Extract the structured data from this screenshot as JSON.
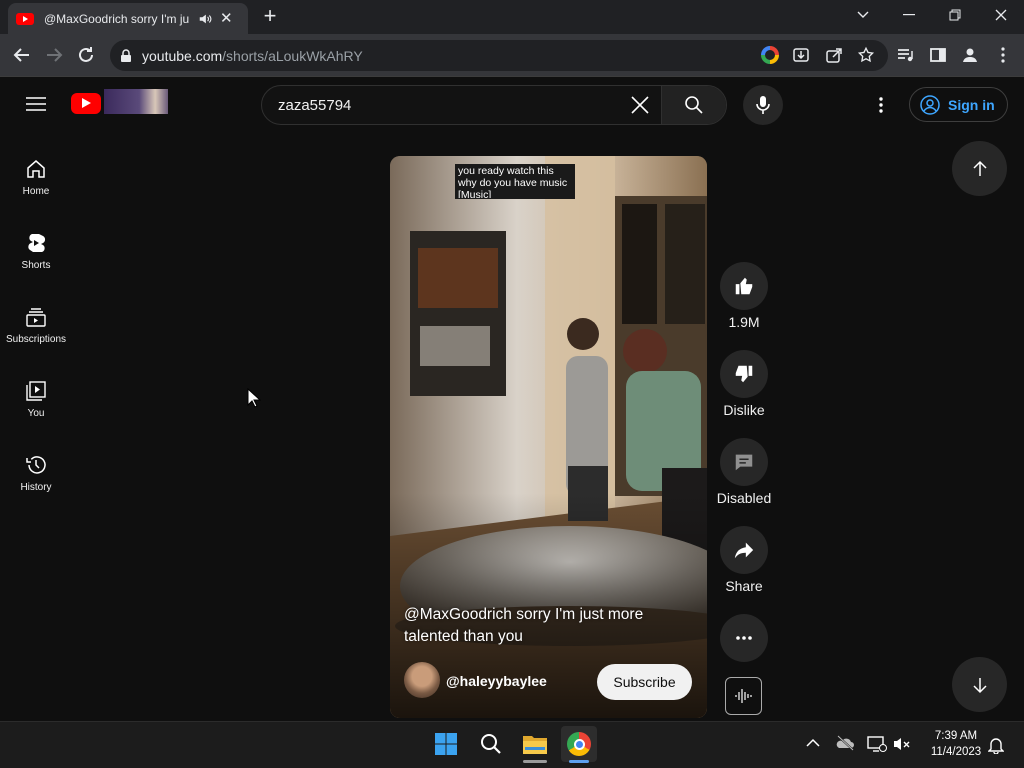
{
  "browser": {
    "tab_title": "@MaxGoodrich sorry I'm ju",
    "url_domain": "youtube.com",
    "url_path": "/shorts/aLoukWkAhRY"
  },
  "header": {
    "search_value": "zaza55794",
    "sign_in_label": "Sign in"
  },
  "guide": {
    "items": [
      {
        "label": "Home",
        "icon": "home-icon"
      },
      {
        "label": "Shorts",
        "icon": "shorts-icon"
      },
      {
        "label": "Subscriptions",
        "icon": "subscriptions-icon"
      },
      {
        "label": "You",
        "icon": "you-icon"
      },
      {
        "label": "History",
        "icon": "history-icon"
      }
    ]
  },
  "video": {
    "caption_lines": [
      "you ready watch this",
      "why do you have music",
      "[Music]"
    ],
    "title": "@MaxGoodrich sorry I'm just more talented than you",
    "channel": "@haleyybaylee",
    "subscribe_label": "Subscribe"
  },
  "actions": {
    "like_count": "1.9M",
    "dislike_label": "Dislike",
    "comments_label": "Disabled",
    "share_label": "Share"
  },
  "taskbar": {
    "time": "7:39 AM",
    "date": "11/4/2023"
  },
  "colors": {
    "accent_blue": "#3ea6ff",
    "youtube_red": "#ff0000",
    "background": "#0f0f0f"
  }
}
